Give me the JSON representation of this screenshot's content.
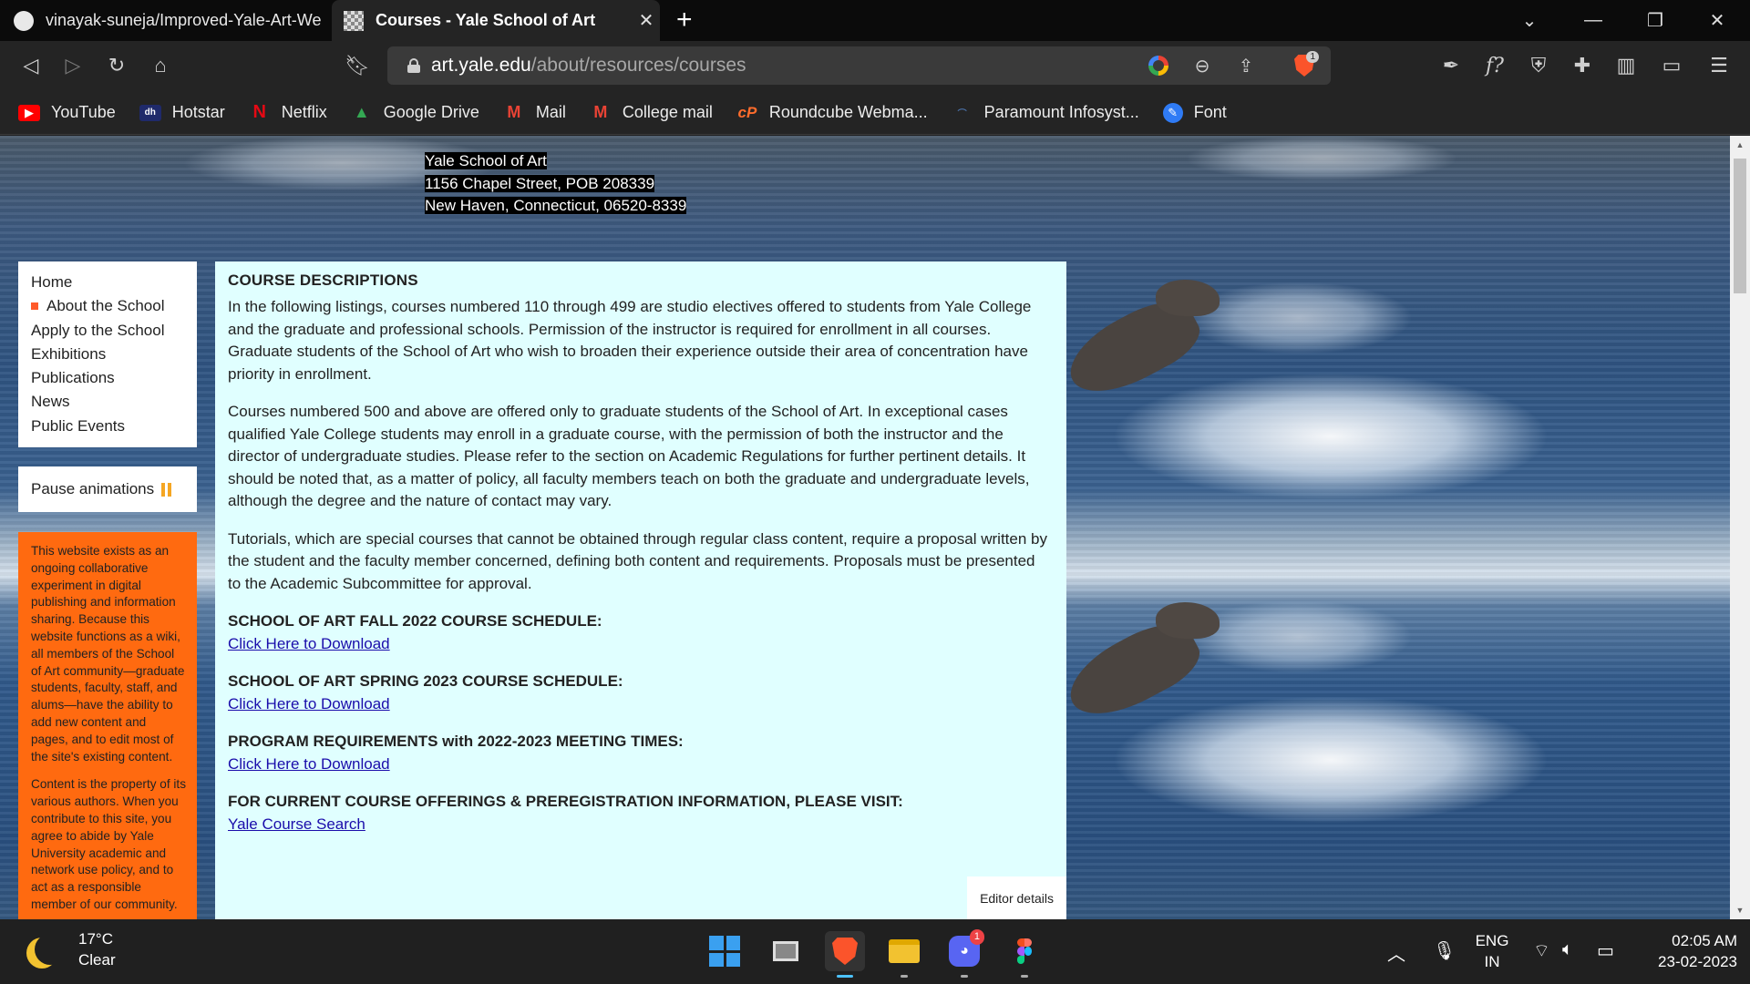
{
  "browser": {
    "tabs": [
      {
        "title": "vinayak-suneja/Improved-Yale-Art-We",
        "active": false
      },
      {
        "title": "Courses - Yale School of Art",
        "active": true
      }
    ],
    "url_host": "art.yale.edu",
    "url_path": "/about/resources/courses",
    "shield_badge": "1",
    "bookmarks": [
      {
        "label": "YouTube",
        "icon": "youtube-icon",
        "color": "#ff0000"
      },
      {
        "label": "Hotstar",
        "icon": "hotstar-icon",
        "color": "#1f2a6b"
      },
      {
        "label": "Netflix",
        "icon": "netflix-icon",
        "color": "#e50914"
      },
      {
        "label": "Google Drive",
        "icon": "google-drive-icon",
        "color": "#34a853"
      },
      {
        "label": "Mail",
        "icon": "gmail-icon",
        "color": "#ea4335"
      },
      {
        "label": "College mail",
        "icon": "gmail-icon",
        "color": "#ea4335"
      },
      {
        "label": "Roundcube Webma...",
        "icon": "cpanel-icon",
        "color": "#ff6c2c"
      },
      {
        "label": "Paramount Infosyst...",
        "icon": "paramount-icon",
        "color": "#4a6fa5"
      },
      {
        "label": "Font",
        "icon": "font-icon",
        "color": "#2f7bf5"
      }
    ]
  },
  "page": {
    "address": [
      "Yale School of Art",
      "1156 Chapel Street, POB 208339",
      "New Haven, Connecticut, 06520-8339"
    ],
    "nav": [
      {
        "label": "Home",
        "current": false
      },
      {
        "label": "About the School",
        "current": true
      },
      {
        "label": "Apply to the School",
        "current": false
      },
      {
        "label": "Exhibitions",
        "current": false
      },
      {
        "label": "Publications",
        "current": false
      },
      {
        "label": "News",
        "current": false
      },
      {
        "label": "Public Events",
        "current": false
      }
    ],
    "pause_label": "Pause animations",
    "info_paragraphs": [
      "This website exists as an ongoing collaborative experiment in digital publishing and information sharing. Because this website functions as a wiki, all members of the School of Art community—graduate students, faculty, staff, and alums—have the ability to add new content and pages, and to edit most of the site's existing content.",
      "Content is the property of its various authors. When you contribute to this site, you agree to abide by Yale University academic and network use policy, and to act as a responsible member of our community."
    ],
    "content": {
      "heading": "COURSE DESCRIPTIONS",
      "paragraphs": [
        "In the following listings, courses numbered 110 through 499 are studio electives offered to students from Yale College and the graduate and professional schools. Permission of the instructor is required for enrollment in all courses. Graduate students of the School of Art who wish to broaden their experience outside their area of concentration have priority in enrollment.",
        "Courses numbered 500 and above are offered only to graduate students of the School of Art. In exceptional cases qualified Yale College students may enroll in a graduate course, with the permission of both the instructor and the director of undergraduate studies. Please refer to the section on Academic Regulations for further pertinent details. It should be noted that, as a matter of policy, all faculty members teach on both the graduate and undergraduate levels, although the degree and the nature of contact may vary.",
        "Tutorials, which are special courses that cannot be obtained through regular class content, require a proposal written by the student and the faculty member concerned, defining both content and requirements. Proposals must be presented to the Academic Subcommittee for approval."
      ],
      "sections": [
        {
          "title": "SCHOOL OF ART FALL 2022 COURSE SCHEDULE:",
          "link": "Click Here to Download"
        },
        {
          "title": "SCHOOL OF ART SPRING 2023 COURSE SCHEDULE:",
          "link": "Click Here to Download"
        },
        {
          "title": "PROGRAM REQUIREMENTS with 2022-2023 MEETING TIMES:",
          "link": "Click Here to Download"
        },
        {
          "title": "FOR CURRENT COURSE OFFERINGS & PREREGISTRATION INFORMATION, PLEASE VISIT:",
          "link": "Yale Course Search"
        }
      ],
      "editor_label": "Editor details"
    }
  },
  "taskbar": {
    "temperature": "17°C",
    "condition": "Clear",
    "language": "ENG",
    "region": "IN",
    "time": "02:05 AM",
    "date": "23-02-2023",
    "discord_badge": "1"
  },
  "colors": {
    "content_bg": "#e0ffff",
    "info_bg": "#ff6a10",
    "link": "#1a0dab",
    "nav_marker": "#ff5a2a"
  }
}
